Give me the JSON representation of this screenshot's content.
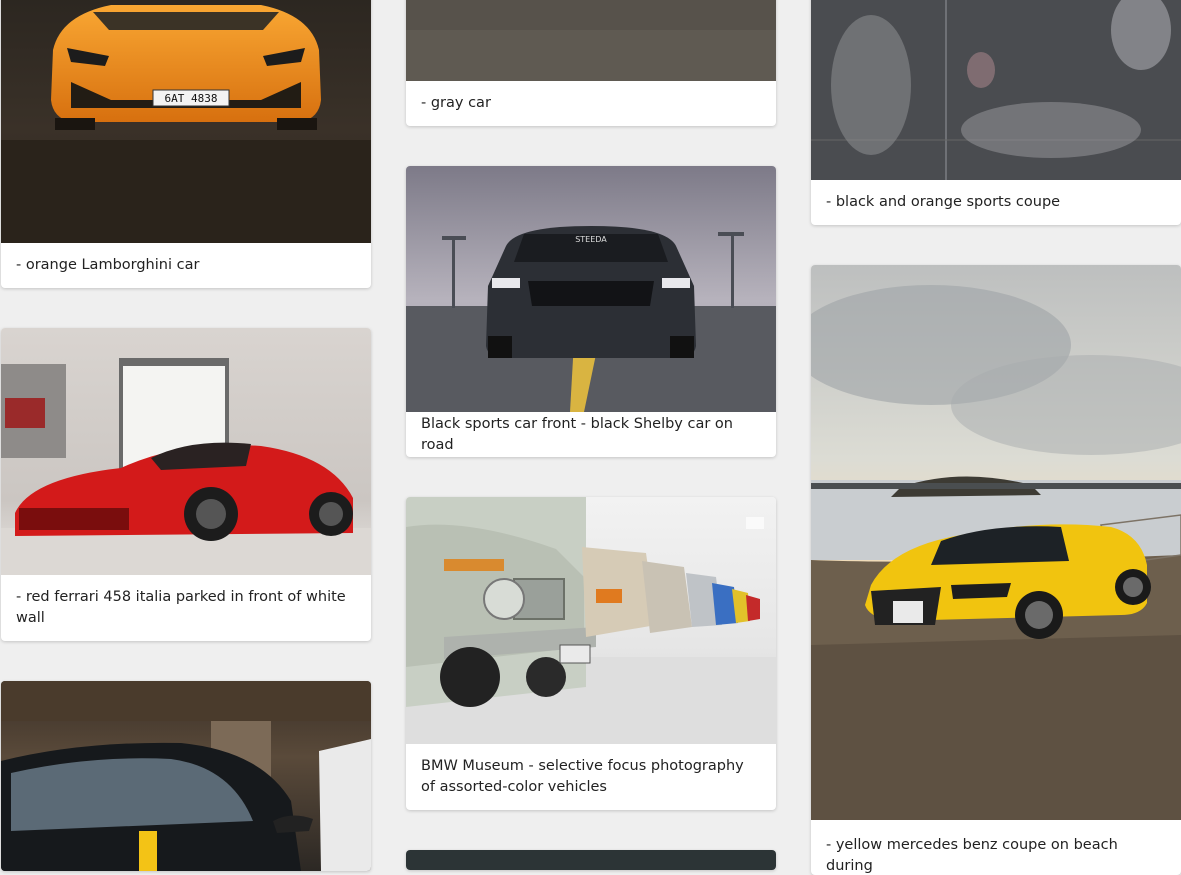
{
  "gallery": {
    "captions": {
      "orange_lambo": "- orange Lamborghini car",
      "red_ferrari": "- red ferrari 458 italia parked in front of white wall",
      "gray_car": "- gray car",
      "black_shelby": "Black sports car front - black Shelby car on road",
      "bmw_museum": "BMW Museum - selective focus photography of assorted-color vehicles",
      "black_orange_coupe": "- black and orange sports coupe",
      "yellow_audi": "- yellow mercedes benz coupe on beach during"
    },
    "plates": {
      "lambo": "6AT 4838",
      "mustang": "STEEDA"
    }
  }
}
